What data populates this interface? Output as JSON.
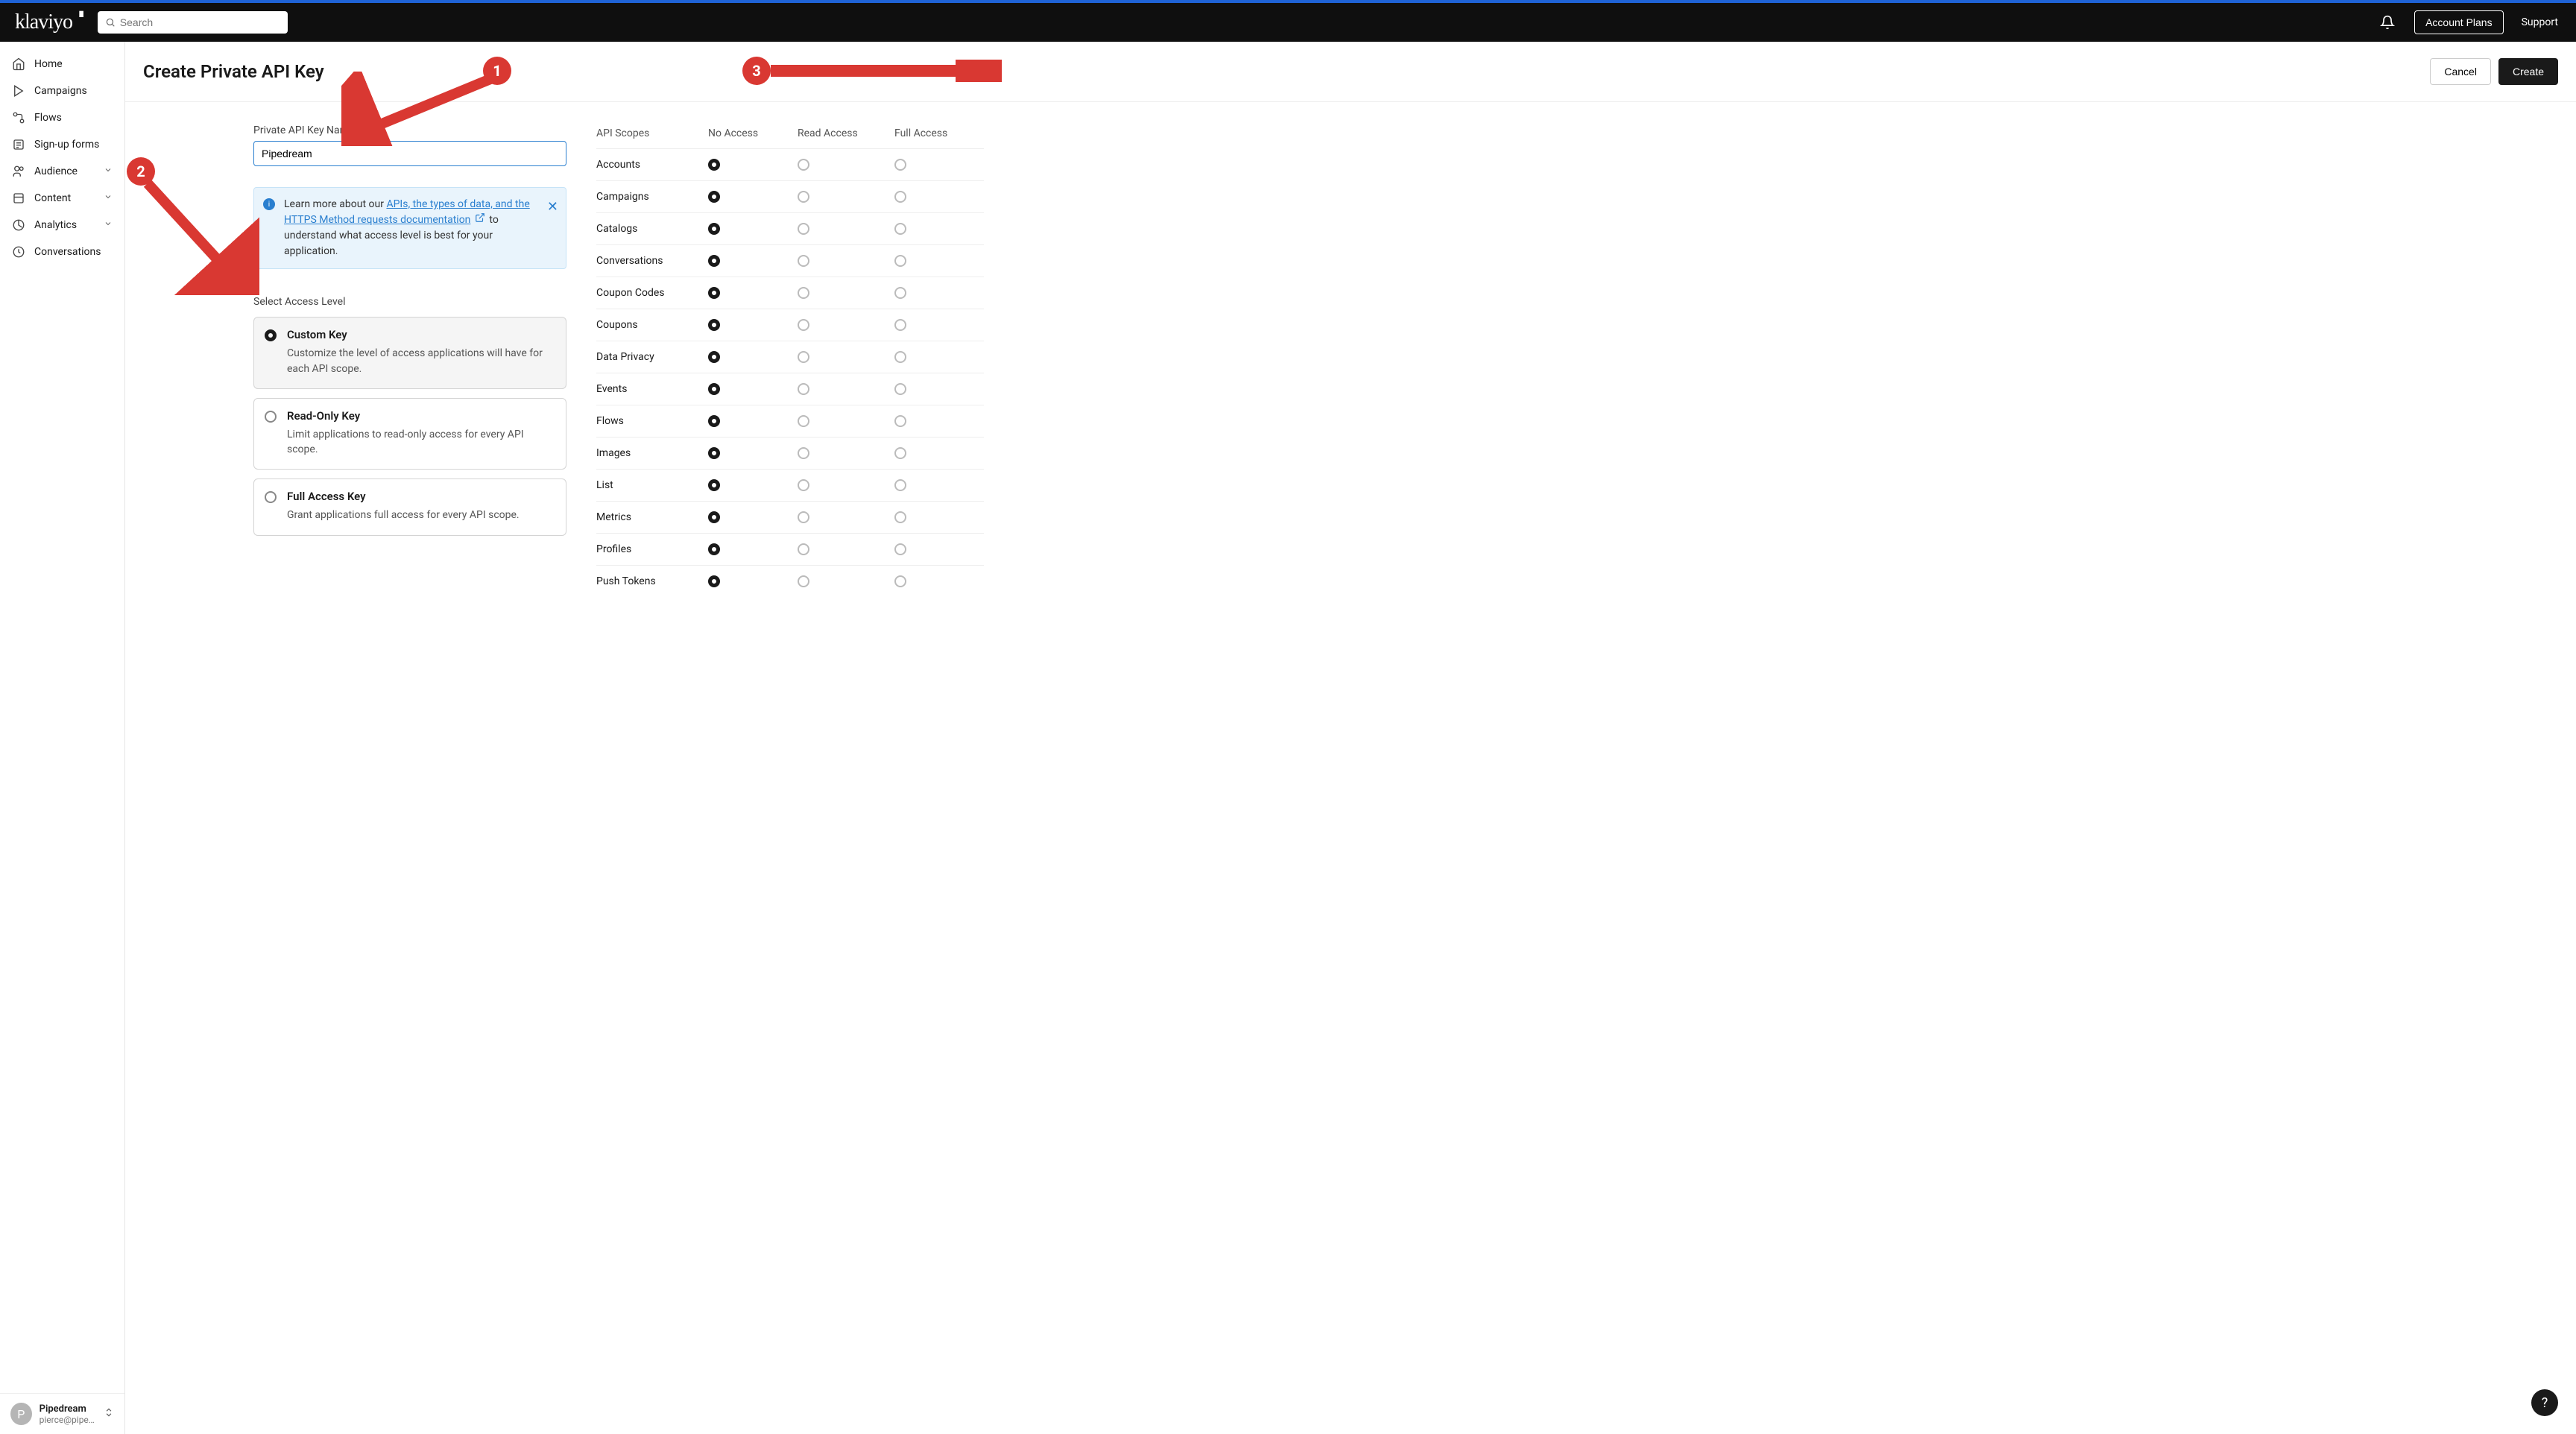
{
  "brand": "klaviyo",
  "search": {
    "placeholder": "Search"
  },
  "header": {
    "account_plans": "Account Plans",
    "support": "Support"
  },
  "sidebar": {
    "items": [
      {
        "label": "Home",
        "icon": "home",
        "expandable": false
      },
      {
        "label": "Campaigns",
        "icon": "campaigns",
        "expandable": false
      },
      {
        "label": "Flows",
        "icon": "flows",
        "expandable": false
      },
      {
        "label": "Sign-up forms",
        "icon": "forms",
        "expandable": false
      },
      {
        "label": "Audience",
        "icon": "audience",
        "expandable": true
      },
      {
        "label": "Content",
        "icon": "content",
        "expandable": true
      },
      {
        "label": "Analytics",
        "icon": "analytics",
        "expandable": true
      },
      {
        "label": "Conversations",
        "icon": "conversations",
        "expandable": false
      }
    ]
  },
  "account": {
    "avatar_initial": "P",
    "name": "Pipedream",
    "email": "pierce@piped..."
  },
  "page": {
    "title": "Create Private API Key",
    "cancel": "Cancel",
    "create": "Create"
  },
  "form": {
    "name_label": "Private API Key Name",
    "name_value": "Pipedream"
  },
  "banner": {
    "prefix": "Learn more about our ",
    "link1": "APIs, the types of data, and the HTTPS Method requests documentation",
    "suffix": " to understand what access level is best for your application."
  },
  "access": {
    "label": "Select Access Level",
    "options": [
      {
        "title": "Custom Key",
        "desc": "Customize the level of access applications will have for each API scope.",
        "selected": true
      },
      {
        "title": "Read-Only Key",
        "desc": "Limit applications to read-only access for every API scope.",
        "selected": false
      },
      {
        "title": "Full Access Key",
        "desc": "Grant applications full access for every API scope.",
        "selected": false
      }
    ]
  },
  "scopes": {
    "header": {
      "scope": "API Scopes",
      "no": "No Access",
      "read": "Read Access",
      "full": "Full Access"
    },
    "rows": [
      {
        "name": "Accounts",
        "sel": "no"
      },
      {
        "name": "Campaigns",
        "sel": "no"
      },
      {
        "name": "Catalogs",
        "sel": "no"
      },
      {
        "name": "Conversations",
        "sel": "no"
      },
      {
        "name": "Coupon Codes",
        "sel": "no"
      },
      {
        "name": "Coupons",
        "sel": "no"
      },
      {
        "name": "Data Privacy",
        "sel": "no"
      },
      {
        "name": "Events",
        "sel": "no"
      },
      {
        "name": "Flows",
        "sel": "no"
      },
      {
        "name": "Images",
        "sel": "no"
      },
      {
        "name": "List",
        "sel": "no"
      },
      {
        "name": "Metrics",
        "sel": "no"
      },
      {
        "name": "Profiles",
        "sel": "no"
      },
      {
        "name": "Push Tokens",
        "sel": "no"
      }
    ]
  },
  "annotations": {
    "b1": "1",
    "b2": "2",
    "b3": "3"
  },
  "help": "?"
}
